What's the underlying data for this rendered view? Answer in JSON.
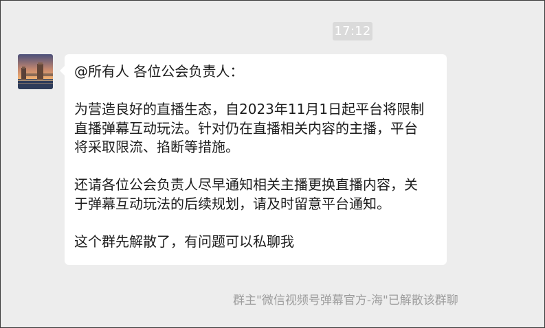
{
  "chat": {
    "timestamp": "17:12",
    "message": {
      "lines": [
        "@所有人 各位公会负责人：",
        "",
        "为营造良好的直播生态，自2023年11月1日起平台将限制",
        "直播弹幕互动玩法。针对仍在直播相关内容的主播，平台",
        "将采取限流、掐断等措施。",
        "",
        "还请各位公会负责人尽早通知相关主播更换直播内容，关",
        "于弹幕互动玩法的后续规划，请及时留意平台通知。",
        "",
        "这个群先解散了，有问题可以私聊我"
      ]
    },
    "system_notice": "群主\"微信视频号弹幕官方-海\"已解散该群聊"
  },
  "colors": {
    "background": "#ededed",
    "bubble": "#ffffff",
    "timestamp_badge": "#dadada",
    "notice_text": "#9d9d9d"
  }
}
